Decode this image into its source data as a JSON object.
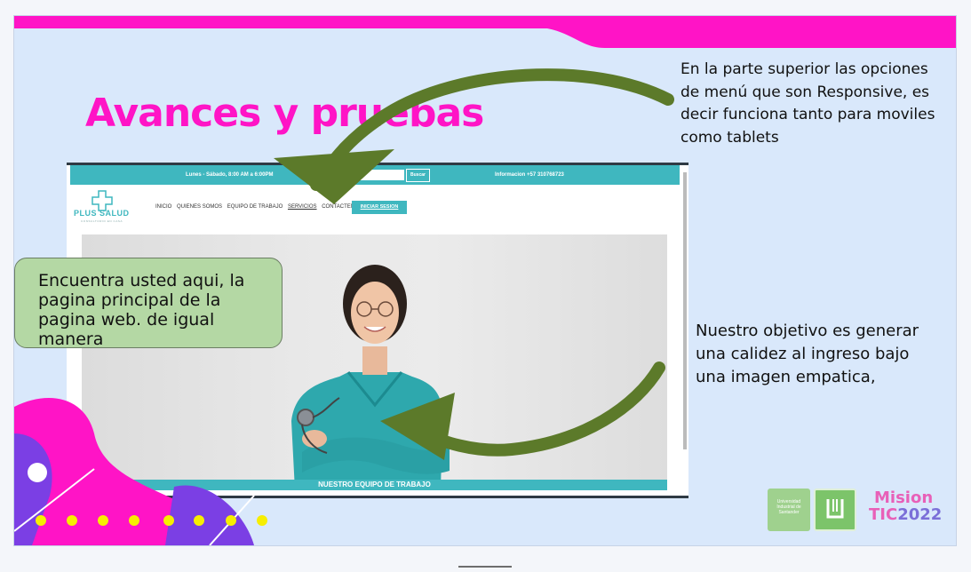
{
  "slide": {
    "title": "Avances y pruebas",
    "note_top": "En la parte superior las opciones de menú que son Responsive, es decir funciona tanto para moviles como tablets",
    "note_right": "Nuestro objetivo es generar una calidez al ingreso bajo una imagen empatica,",
    "callout": "Encuentra usted aqui, la pagina principal de la pagina web. de igual manera"
  },
  "website": {
    "hours": "Lunes - Sábado, 8:00 AM a 6:00PM",
    "search_button": "Buscar",
    "info": "Informacion +57 310768723",
    "logo_name": "PLUS SALUD",
    "logo_tagline": "CONSULTORIO EN CASA",
    "nav": [
      "INICIO",
      "QUIENES SOMOS",
      "EQUIPO DE TRABAJO",
      "SERVICIOS",
      "CONTACTENOS"
    ],
    "login_button": "INICIAR SESION",
    "hero_caption": "NUESTRO EQUIPO DE TRABAJO"
  },
  "branding": {
    "uis_text": "Universidad Industrial de Santander",
    "mision_line1": "Mision",
    "mision_line2": "TIC",
    "mision_year": "2022"
  },
  "colors": {
    "accent_pink": "#ff14c6",
    "teal": "#3fb7bf",
    "arrow_green": "#5c7a2a",
    "callout_green": "#b4d8a4"
  }
}
